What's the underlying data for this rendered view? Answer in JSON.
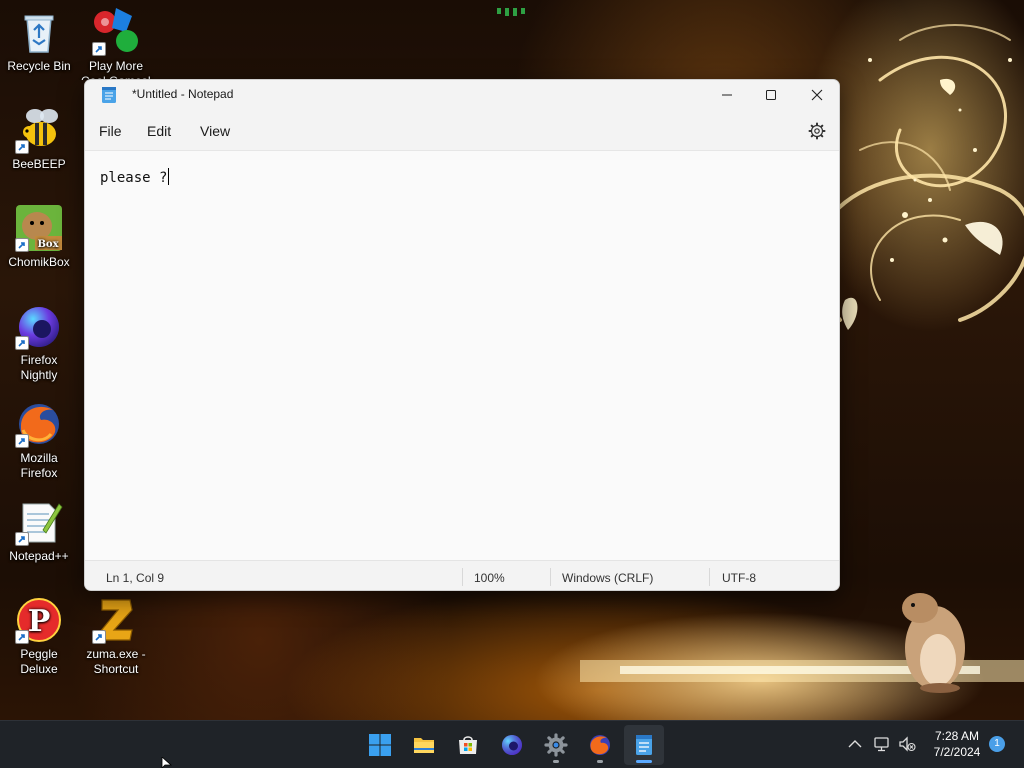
{
  "desktop": {
    "icons": [
      {
        "label": "Recycle Bin",
        "icon": "recycle-bin-icon",
        "shortcut": false
      },
      {
        "label": "Play More Cool Games!",
        "icon": "game-balls-icon",
        "shortcut": true
      },
      {
        "label": "BeeBEEP",
        "icon": "bee-icon",
        "shortcut": true
      },
      {
        "label": "ChomikBox",
        "icon": "hamster-box-icon",
        "shortcut": true
      },
      {
        "label": "Firefox Nightly",
        "icon": "firefox-nightly-icon",
        "shortcut": true
      },
      {
        "label": "Mozilla Firefox",
        "icon": "firefox-icon",
        "shortcut": true
      },
      {
        "label": "Notepad++",
        "icon": "notepad-plus-plus-icon",
        "shortcut": true
      },
      {
        "label": "Peggle Deluxe",
        "icon": "peggle-icon",
        "shortcut": true
      },
      {
        "label": "zuma.exe - Shortcut",
        "icon": "zuma-icon",
        "shortcut": true
      }
    ]
  },
  "notepad": {
    "title": "*Untitled - Notepad",
    "menus": {
      "file": "File",
      "edit": "Edit",
      "view": "View"
    },
    "content": "please ?",
    "status": {
      "position": "Ln 1, Col 9",
      "zoom": "100%",
      "line_ending": "Windows (CRLF)",
      "encoding": "UTF-8"
    }
  },
  "taskbar": {
    "apps": [
      {
        "name": "start",
        "icon": "windows-start-icon",
        "running": false,
        "active": false
      },
      {
        "name": "file-explorer",
        "icon": "folder-icon",
        "running": false,
        "active": false
      },
      {
        "name": "microsoft-store",
        "icon": "store-icon",
        "running": false,
        "active": false
      },
      {
        "name": "firefox-nightly",
        "icon": "firefox-nightly-icon",
        "running": false,
        "active": false
      },
      {
        "name": "settings",
        "icon": "gear-icon",
        "running": true,
        "active": false
      },
      {
        "name": "firefox",
        "icon": "firefox-icon",
        "running": true,
        "active": false
      },
      {
        "name": "notepad",
        "icon": "notepad-icon",
        "running": true,
        "active": true
      }
    ],
    "clock": {
      "time": "7:28 AM",
      "date": "7/2/2024"
    },
    "notification_count": "1"
  },
  "colors": {
    "accent": "#5aa9ff",
    "taskbar_bg": "#1f2328",
    "window_bg": "#f9f9f9"
  }
}
